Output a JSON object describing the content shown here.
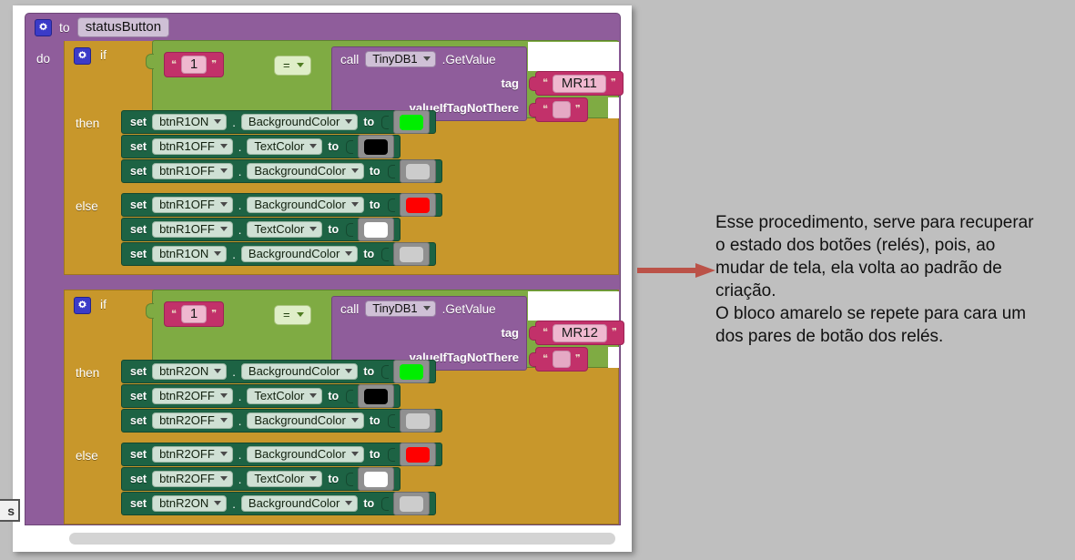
{
  "procedure": {
    "gear_icon": "gear-icon",
    "to_keyword": "to",
    "name": "statusButton",
    "do_keyword": "do"
  },
  "blocks": [
    {
      "if_keyword": "if",
      "gear_icon": "gear-icon",
      "condition": {
        "left_value": "1",
        "operator": "=",
        "call_keyword": "call",
        "component": "TinyDB1",
        "method": ".GetValue",
        "tag_label": "tag",
        "tag_value": "MR11",
        "default_label": "valueIfTagNotThere",
        "default_value": ""
      },
      "then_label": "then",
      "then_rows": [
        {
          "set": "set",
          "component": "btnR1ON",
          "property": "BackgroundColor",
          "to": "to",
          "color": "#00ee00"
        },
        {
          "set": "set",
          "component": "btnR1OFF",
          "property": "TextColor",
          "to": "to",
          "color": "#000000"
        },
        {
          "set": "set",
          "component": "btnR1OFF",
          "property": "BackgroundColor",
          "to": "to",
          "color": "#cccccc"
        }
      ],
      "else_label": "else",
      "else_rows": [
        {
          "set": "set",
          "component": "btnR1OFF",
          "property": "BackgroundColor",
          "to": "to",
          "color": "#ff0000"
        },
        {
          "set": "set",
          "component": "btnR1OFF",
          "property": "TextColor",
          "to": "to",
          "color": "#ffffff"
        },
        {
          "set": "set",
          "component": "btnR1ON",
          "property": "BackgroundColor",
          "to": "to",
          "color": "#cccccc"
        }
      ]
    },
    {
      "if_keyword": "if",
      "gear_icon": "gear-icon",
      "condition": {
        "left_value": "1",
        "operator": "=",
        "call_keyword": "call",
        "component": "TinyDB1",
        "method": ".GetValue",
        "tag_label": "tag",
        "tag_value": "MR12",
        "default_label": "valueIfTagNotThere",
        "default_value": ""
      },
      "then_label": "then",
      "then_rows": [
        {
          "set": "set",
          "component": "btnR2ON",
          "property": "BackgroundColor",
          "to": "to",
          "color": "#00ee00"
        },
        {
          "set": "set",
          "component": "btnR2OFF",
          "property": "TextColor",
          "to": "to",
          "color": "#000000"
        },
        {
          "set": "set",
          "component": "btnR2OFF",
          "property": "BackgroundColor",
          "to": "to",
          "color": "#cccccc"
        }
      ],
      "else_label": "else",
      "else_rows": [
        {
          "set": "set",
          "component": "btnR2OFF",
          "property": "BackgroundColor",
          "to": "to",
          "color": "#ff0000"
        },
        {
          "set": "set",
          "component": "btnR2OFF",
          "property": "TextColor",
          "to": "to",
          "color": "#ffffff"
        },
        {
          "set": "set",
          "component": "btnR2ON",
          "property": "BackgroundColor",
          "to": "to",
          "color": "#cccccc"
        }
      ]
    }
  ],
  "annotation": {
    "line1": "Esse procedimento, serve para recuperar",
    "line2": "o estado dos botões (relés), pois, ao",
    "line3": "mudar de tela, ela volta ao padrão de",
    "line4": "criação.",
    "line5": "O bloco amarelo se repete para cara um",
    "line6": "dos pares de botão dos relés.",
    "arrow_icon": "right-arrow-icon",
    "arrow_color": "#bb5248"
  },
  "chrome": {
    "tooltip_fragment": "s",
    "scrollbar_icon": "horizontal-scrollbar"
  },
  "colors": {
    "background": "#bfbfbf",
    "canvas": "#ffffff",
    "procedure": "#8f5d9b",
    "control": "#c8972b",
    "logic": "#7fab43",
    "text_block": "#c2316a",
    "component_set": "#1d6344"
  }
}
